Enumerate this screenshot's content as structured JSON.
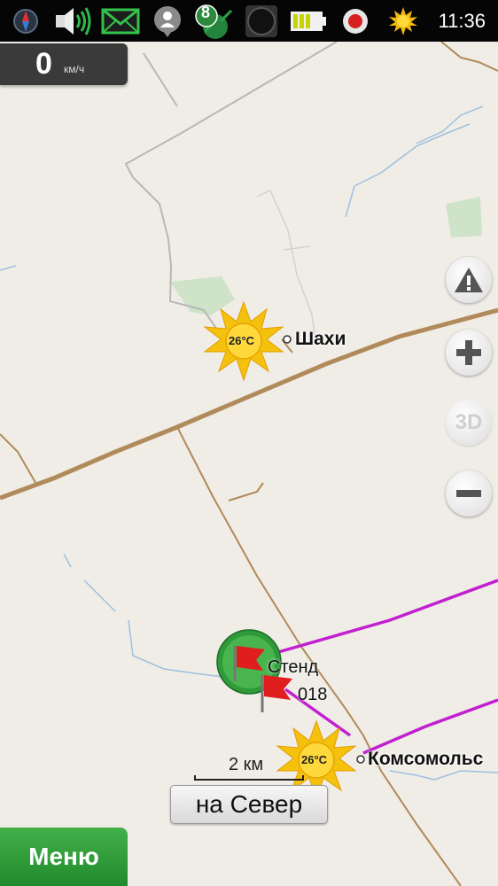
{
  "status_bar": {
    "time": "11:36",
    "icons": [
      "compass-icon",
      "volume-icon",
      "message-icon",
      "location-pin-icon",
      "satellite-icon",
      "camera-icon",
      "battery-icon",
      "record-icon",
      "weather-sun-icon"
    ],
    "satellite_count": "8"
  },
  "speed": {
    "value": "0",
    "unit": "км/ч"
  },
  "map_labels": {
    "city_1": "Шахи",
    "city_2": "Комсомольс",
    "poi_name": "Стенд",
    "poi_code": "018",
    "weather_1": "26°C",
    "weather_2": "26°C"
  },
  "controls": {
    "warning": "warning-icon",
    "zoom_in": "plus-icon",
    "mode_3d": "3D",
    "zoom_out": "minus-icon"
  },
  "scale": {
    "label": "2 км"
  },
  "buttons": {
    "north": "на Север",
    "menu": "Меню"
  },
  "colors": {
    "road": "#b08a5a",
    "route": "#c21fd1",
    "water": "#9ebfe0",
    "park": "#cfe3c8",
    "menu_green": "#2a9a36"
  }
}
